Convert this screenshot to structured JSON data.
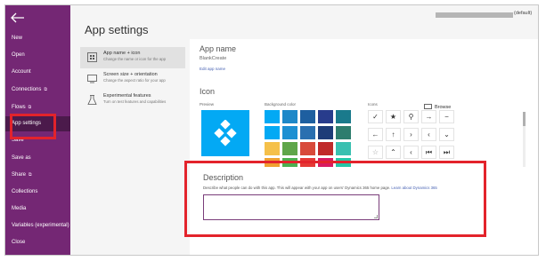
{
  "sidebar": {
    "items": [
      {
        "label": "New"
      },
      {
        "label": "Open"
      },
      {
        "label": "Account"
      },
      {
        "label": "Connections",
        "external": "⧉"
      },
      {
        "label": "Flows",
        "external": "⧉"
      },
      {
        "label": "App settings"
      },
      {
        "label": "Save"
      },
      {
        "label": "Save as"
      },
      {
        "label": "Share",
        "external": "⧉"
      },
      {
        "label": "Collections"
      },
      {
        "label": "Media"
      },
      {
        "label": "Variables (experimental)"
      },
      {
        "label": "Close"
      }
    ],
    "back_icon": "arrow-left-icon",
    "active_index": 5
  },
  "page": {
    "title": "App settings"
  },
  "user": {
    "suffix": "(default)"
  },
  "subnav": [
    {
      "title": "App name + icon",
      "subtitle": "Change the name or icon for the app",
      "icon": "app-icon"
    },
    {
      "title": "Screen size + orientation",
      "subtitle": "Change the aspect ratio for your app",
      "icon": "screen-icon"
    },
    {
      "title": "Experimental features",
      "subtitle": "Turn on test features and capabilities",
      "icon": "flask-icon"
    }
  ],
  "app_name": {
    "heading": "App name",
    "value": "BlankCreate",
    "edit_link": "Edit app name"
  },
  "icon_section": {
    "heading": "Icon",
    "preview_label": "Preview",
    "bg_label": "Background color",
    "icons_label": "Icons",
    "browse_label": "Browse",
    "colors": [
      "#03a9f4",
      "#1e88c8",
      "#1e5fa0",
      "#283c8c",
      "#1a7a8c",
      "#03a9f4",
      "#1e90d2",
      "#2a6fb0",
      "#1e3c78",
      "#2e7d6e",
      "#f5c04a",
      "#5fa64a",
      "#d84a3a",
      "#c02a2a",
      "#3ac0b0",
      "#f0a030",
      "#4caf50",
      "#e53935",
      "#d81b60",
      "#26c6a6"
    ],
    "icons": [
      {
        "glyph": "✓",
        "name": "check-icon"
      },
      {
        "glyph": "★",
        "name": "star-icon"
      },
      {
        "glyph": "⚲",
        "name": "search-icon"
      },
      {
        "glyph": "→",
        "name": "arrow-right-icon"
      },
      {
        "glyph": "−",
        "name": "minus-icon"
      },
      {
        "glyph": "←",
        "name": "arrow-left-icon"
      },
      {
        "glyph": "↑",
        "name": "arrow-up-icon"
      },
      {
        "glyph": "›",
        "name": "chevron-right-icon"
      },
      {
        "glyph": "‹",
        "name": "chevron-left-icon"
      },
      {
        "glyph": "⌄",
        "name": "chevron-down-icon"
      },
      {
        "glyph": "☆",
        "name": "star-outline-icon"
      },
      {
        "glyph": "⌃",
        "name": "chevron-up-icon"
      },
      {
        "glyph": "‹",
        "name": "chevron-left-small-icon"
      },
      {
        "glyph": "⏮",
        "name": "skip-back-icon"
      },
      {
        "glyph": "⏭",
        "name": "skip-forward-icon"
      }
    ]
  },
  "description": {
    "heading": "Description",
    "help": "Describe what people can do with this app. This will appear with your app on users' Dynamics 365 home page.",
    "link": "Learn about Dynamics 365",
    "value": ""
  }
}
